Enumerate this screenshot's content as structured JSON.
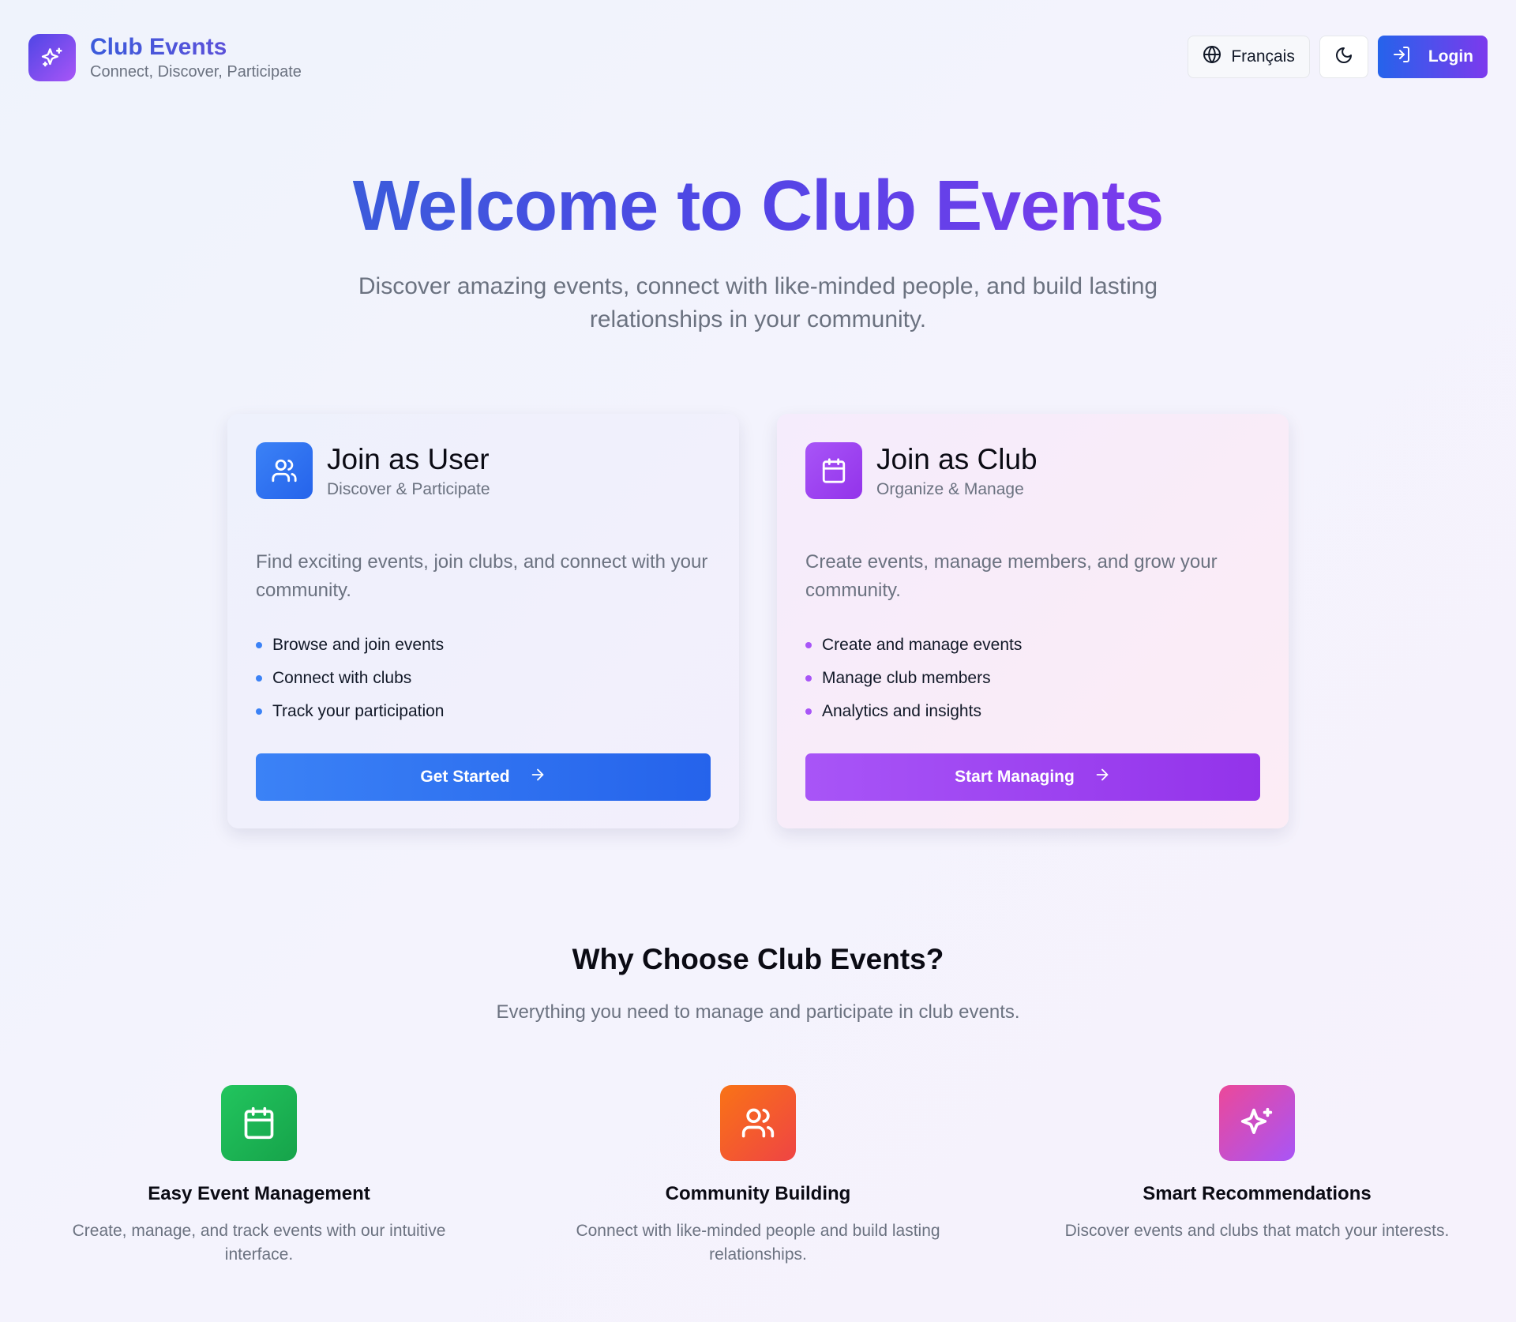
{
  "header": {
    "brand_title": "Club Events",
    "brand_subtitle": "Connect, Discover, Participate",
    "brand_icon": "sparkles-icon",
    "language_label": "Français",
    "language_icon": "globe-icon",
    "theme_icon": "moon-icon",
    "login_label": "Login",
    "login_icon": "log-in-icon"
  },
  "hero": {
    "title": "Welcome to Club Events",
    "subtitle": "Discover amazing events, connect with like-minded people, and build lasting relationships in your community."
  },
  "cards": {
    "user": {
      "icon": "users-icon",
      "title": "Join as User",
      "subtitle": "Discover & Participate",
      "description": "Find exciting events, join clubs, and connect with your community.",
      "features": [
        "Browse and join events",
        "Connect with clubs",
        "Track your participation"
      ],
      "button_label": "Get Started",
      "accent": "#3b82f6"
    },
    "club": {
      "icon": "calendar-icon",
      "title": "Join as Club",
      "subtitle": "Organize & Manage",
      "description": "Create events, manage members, and grow your community.",
      "features": [
        "Create and manage events",
        "Manage club members",
        "Analytics and insights"
      ],
      "button_label": "Start Managing",
      "accent": "#a855f7"
    }
  },
  "why": {
    "title": "Why Choose Club Events?",
    "subtitle": "Everything you need to manage and participate in club events.",
    "features": [
      {
        "icon": "calendar-icon",
        "title": "Easy Event Management",
        "description": "Create, manage, and track events with our intuitive interface.",
        "color": "#22c55e"
      },
      {
        "icon": "users-icon",
        "title": "Community Building",
        "description": "Connect with like-minded people and build lasting relationships.",
        "color": "#f97316"
      },
      {
        "icon": "sparkles-icon",
        "title": "Smart Recommendations",
        "description": "Discover events and clubs that match your interests.",
        "color": "#ec4899"
      }
    ]
  }
}
